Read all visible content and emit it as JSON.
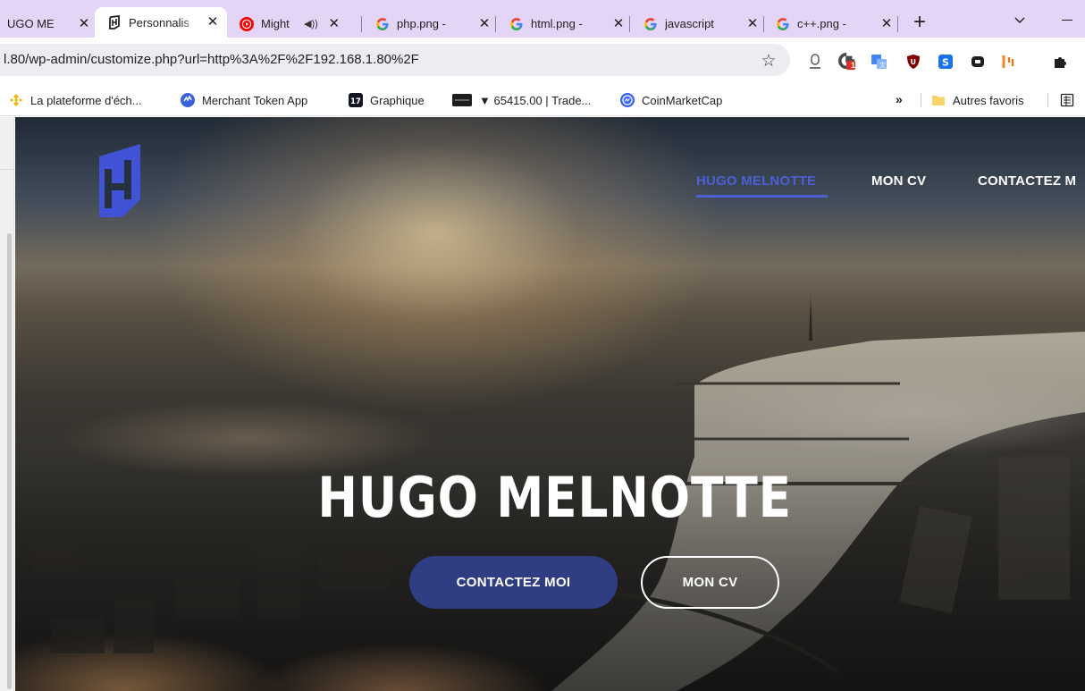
{
  "browser": {
    "tabs": [
      {
        "title": "UGO ME",
        "favicon": "site-icon",
        "active": false
      },
      {
        "title": "Personnalis",
        "favicon": "hm-logo-icon",
        "active": true
      },
      {
        "title": "Might",
        "favicon": "youtube-music-icon",
        "active": false,
        "audio": true
      },
      {
        "title": "php.png -",
        "favicon": "google-icon",
        "active": false
      },
      {
        "title": "html.png -",
        "favicon": "google-icon",
        "active": false
      },
      {
        "title": "javascript",
        "favicon": "google-icon",
        "active": false
      },
      {
        "title": "c++.png -",
        "favicon": "google-icon",
        "active": false
      }
    ],
    "new_tab": "+",
    "url": "l.80/wp-admin/customize.php?url=http%3A%2F%2F192.168.1.80%2F",
    "extension_badge": "1",
    "bookmarks": [
      {
        "label": "La plateforme d'éch...",
        "icon": "binance-icon"
      },
      {
        "label": "Merchant Token App",
        "icon": "merchant-icon"
      },
      {
        "label": "Graphique",
        "icon": "tradingview-icon"
      },
      {
        "label": "▼ 65415.00 | Trade...",
        "icon": "trade-icon"
      },
      {
        "label": "CoinMarketCap",
        "icon": "coinmarketcap-icon"
      }
    ],
    "bookmarks_more": "»",
    "other_bookmarks": "Autres favoris"
  },
  "site": {
    "nav": [
      {
        "label": "HUGO MELNOTTE",
        "active": true
      },
      {
        "label": "MON CV",
        "active": false
      },
      {
        "label": "CONTACTEZ M",
        "active": false
      }
    ],
    "hero_title": "HUGO MELNOTTE",
    "cta_primary": "CONTACTEZ MOI",
    "cta_secondary": "MON CV"
  },
  "colors": {
    "tabstrip": "#e4d4f5",
    "accent_blue": "#4e5fd6",
    "button_primary": "#2f3d82"
  }
}
